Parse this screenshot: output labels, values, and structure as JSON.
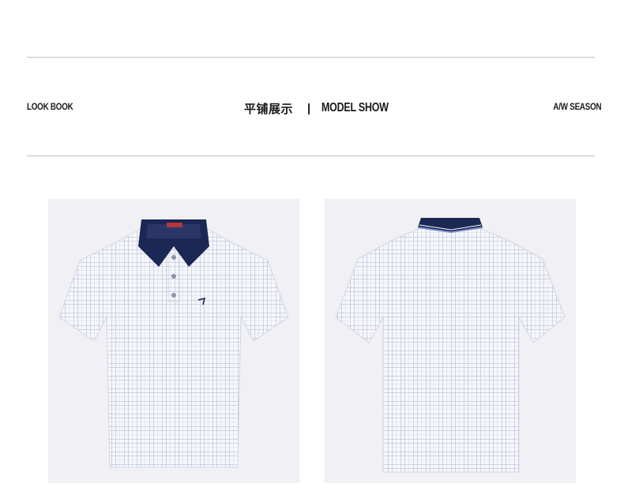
{
  "header": {
    "left_label": "LOOK BOOK",
    "title_cn": "平铺展示",
    "separator": "|",
    "title_en": "MODEL SHOW",
    "right_label": "A/W SEASON"
  },
  "colors": {
    "collar": "#1b2754",
    "shirt": "#f4f5fa",
    "check": "#b8bfd6",
    "background": "#f1f0f4"
  },
  "photos": [
    {
      "view": "front"
    },
    {
      "view": "back"
    }
  ]
}
